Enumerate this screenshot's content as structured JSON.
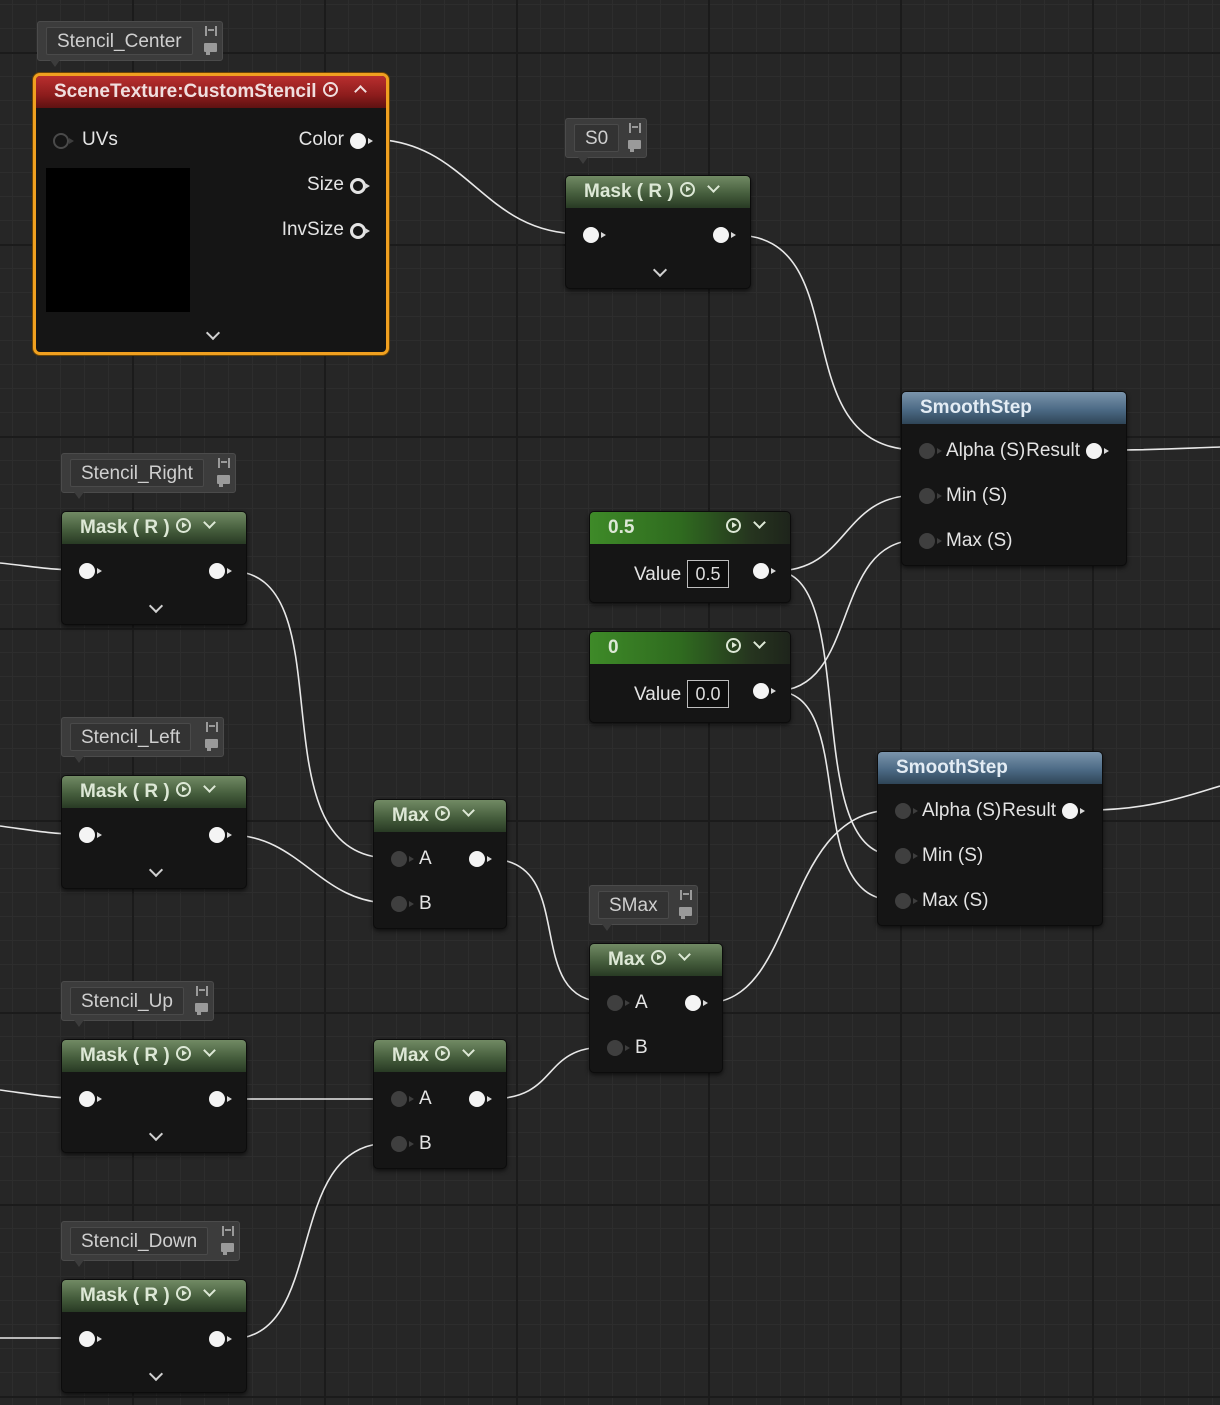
{
  "comments": {
    "stencil_center": "Stencil_Center",
    "s0": "S0",
    "stencil_right": "Stencil_Right",
    "stencil_left": "Stencil_Left",
    "smax": "SMax",
    "stencil_up": "Stencil_Up",
    "stencil_down": "Stencil_Down"
  },
  "nodes": {
    "scene_texture": {
      "title": "SceneTexture:CustomStencil",
      "inputs": [
        "UVs"
      ],
      "outputs": [
        "Color",
        "Size",
        "InvSize"
      ]
    },
    "mask_title": "Mask ( R )",
    "max_title": "Max",
    "max_inputs": [
      "A",
      "B"
    ],
    "smoothstep": {
      "title": "SmoothStep",
      "inputs": [
        "Alpha (S)",
        "Min (S)",
        "Max (S)"
      ],
      "output": "Result"
    },
    "const_half": {
      "title": "0.5",
      "label": "Value",
      "value": "0.5"
    },
    "const_zero": {
      "title": "0",
      "label": "Value",
      "value": "0.0"
    }
  },
  "colors": {
    "mask_header": "#465e3d",
    "constant_header": "#2f6b1f",
    "scene_texture_header": "#8c1c1c",
    "smoothstep_header": "#4c6a85",
    "selection": "#f0a020",
    "wire": "#e8e8e8",
    "background": "#262626"
  }
}
